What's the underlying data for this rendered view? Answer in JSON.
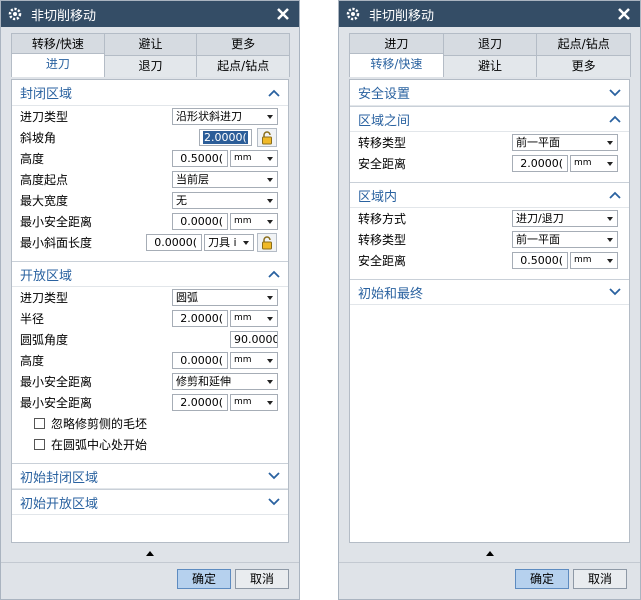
{
  "left": {
    "title": "非切削移动",
    "tabs_back": [
      "转移/快速",
      "避让",
      "更多"
    ],
    "tabs_front": [
      "进刀",
      "退刀",
      "起点/钻点"
    ],
    "closed_area": {
      "title": "封闭区域",
      "rows": [
        {
          "label": "进刀类型",
          "value": "沿形状斜进刀"
        },
        {
          "label": "斜坡角",
          "value": "2.0000("
        },
        {
          "label": "高度",
          "value": "0.5000(",
          "unit": "mm"
        },
        {
          "label": "高度起点",
          "value": "当前层"
        },
        {
          "label": "最大宽度",
          "value": "无"
        },
        {
          "label": "最小安全距离",
          "value": "0.0000(",
          "unit": "mm"
        },
        {
          "label": "最小斜面长度",
          "value": "0.0000(",
          "unit": "刀具 i"
        }
      ]
    },
    "open_area": {
      "title": "开放区域",
      "rows": [
        {
          "label": "进刀类型",
          "value": "圆弧"
        },
        {
          "label": "半径",
          "value": "2.0000(",
          "unit": "mm"
        },
        {
          "label": "圆弧角度",
          "value": "90.0000"
        },
        {
          "label": "高度",
          "value": "0.0000(",
          "unit": "mm"
        },
        {
          "label": "最小安全距离",
          "value": "修剪和延伸"
        },
        {
          "label": "最小安全距离",
          "value": "2.0000(",
          "unit": "mm"
        }
      ],
      "checks": [
        "忽略修剪侧的毛坯",
        "在圆弧中心处开始"
      ]
    },
    "initial_closed": "初始封闭区域",
    "initial_open": "初始开放区域",
    "ok": "确定",
    "cancel": "取消"
  },
  "right": {
    "title": "非切削移动",
    "tabs_back": [
      "进刀",
      "退刀",
      "起点/钻点"
    ],
    "tabs_front": [
      "转移/快速",
      "避让",
      "更多"
    ],
    "safety": {
      "title": "安全设置"
    },
    "between": {
      "title": "区域之间",
      "rows": [
        {
          "label": "转移类型",
          "value": "前一平面"
        },
        {
          "label": "安全距离",
          "value": "2.0000(",
          "unit": "mm"
        }
      ]
    },
    "within": {
      "title": "区域内",
      "rows": [
        {
          "label": "转移方式",
          "value": "进刀/退刀"
        },
        {
          "label": "转移类型",
          "value": "前一平面"
        },
        {
          "label": "安全距离",
          "value": "0.5000(",
          "unit": "mm"
        }
      ]
    },
    "initial_final": {
      "title": "初始和最终"
    },
    "ok": "确定",
    "cancel": "取消"
  }
}
